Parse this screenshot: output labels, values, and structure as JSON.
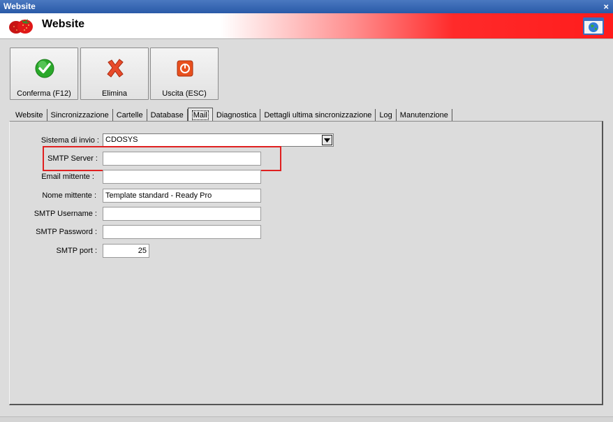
{
  "window": {
    "title": "Website",
    "close_glyph": "×"
  },
  "banner": {
    "title": "Website",
    "logo_icon": "strawberry-logo-icon",
    "right_icon": "globe-window-icon"
  },
  "toolbar": {
    "confirm_label": "Conferma (F12)",
    "delete_label": "Elimina",
    "exit_label": "Uscita (ESC)"
  },
  "tabs": [
    {
      "label": "Website"
    },
    {
      "label": "Sincronizzazione"
    },
    {
      "label": "Cartelle"
    },
    {
      "label": "Database"
    },
    {
      "label": "Mail"
    },
    {
      "label": "Diagnostica"
    },
    {
      "label": "Dettagli ultima sincronizzazione"
    },
    {
      "label": "Log"
    },
    {
      "label": "Manutenzione"
    }
  ],
  "active_tab": "Mail",
  "form": {
    "sistema_label": "Sistema di invio :",
    "sistema_value": "CDOSYS",
    "smtp_server_label": "SMTP Server :",
    "smtp_server_value": "",
    "email_label": "Email mittente :",
    "email_value": "",
    "nome_label": "Nome mittente :",
    "nome_value": "Template standard - Ready Pro",
    "username_label": "SMTP Username :",
    "username_value": "",
    "password_label": "SMTP Password :",
    "password_value": "",
    "port_label": "SMTP port :",
    "port_value": "25"
  },
  "colors": {
    "highlight": "#e02020",
    "titlebar": "#2a5aa8",
    "banner_red": "#ff1c1c"
  }
}
